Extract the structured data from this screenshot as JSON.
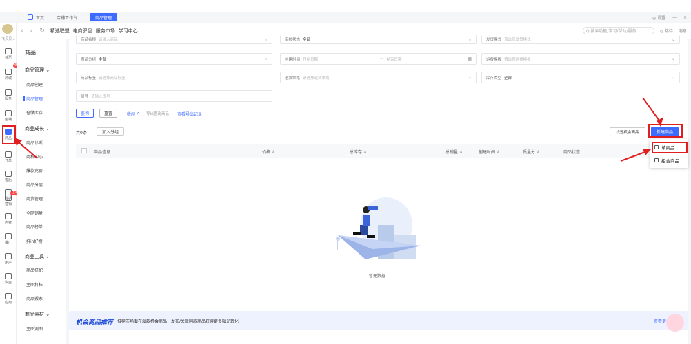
{
  "tabs": [
    {
      "label": "首页",
      "active": false
    },
    {
      "label": "店铺工作台",
      "active": false
    },
    {
      "label": "商品管理",
      "active": true
    }
  ],
  "window_controls": {
    "settings": "◎ 设置",
    "minimize": "—",
    "close": "×"
  },
  "nav": {
    "links": [
      "精选联盟",
      "电商罗盘",
      "服务市场",
      "学习中心"
    ],
    "search_placeholder": "Q 搜索功能/学习/帮助/服务",
    "service": "◎ 接待",
    "message": "消息"
  },
  "sidebar": {
    "shop_name": "飞贝贝...",
    "icons": [
      {
        "name": "home-icon",
        "label": "首页"
      },
      {
        "name": "trade-icon",
        "label": "商城"
      },
      {
        "name": "order-icon",
        "label": "服务"
      },
      {
        "name": "store-icon",
        "label": "店铺"
      },
      {
        "name": "goods-icon",
        "label": "商品",
        "active": true
      },
      {
        "name": "bill-icon",
        "label": "订单"
      },
      {
        "name": "finance-icon",
        "label": "售后"
      },
      {
        "name": "data-icon",
        "label": "数据"
      },
      {
        "name": "market-icon",
        "label": "营销"
      },
      {
        "name": "content-icon",
        "label": "内容"
      },
      {
        "name": "promo-icon",
        "label": "推广"
      },
      {
        "name": "user-icon",
        "label": "用户"
      },
      {
        "name": "funds-icon",
        "label": "资金"
      },
      {
        "name": "app-icon",
        "label": "应用"
      }
    ],
    "badge_new": "免费",
    "badge_hot": "上新"
  },
  "subnav": {
    "title": "商品",
    "groups": [
      {
        "label": "商品管理 ⌄",
        "items": [
          "商品创建",
          "商品管理",
          "仓储库存"
        ]
      },
      {
        "label": "商品成长 ⌄",
        "items": [
          "商品诊断",
          "商机中心",
          "爆款竞价",
          "商品分层",
          "商货管理",
          "全网销量",
          "商品榜单",
          "抖in好物"
        ]
      },
      {
        "label": "商品工具 ⌄",
        "items": [
          "商品搭配",
          "主图打标",
          "商品搬家"
        ]
      },
      {
        "label": "商品素材 ⌄",
        "items": [
          "主图测图"
        ]
      }
    ],
    "active_item": "商品管理"
  },
  "filters": {
    "name": {
      "label": "商品名称",
      "placeholder": "请输入商品"
    },
    "audit": {
      "label": "审核状态",
      "value": "全部"
    },
    "promo": {
      "label": "发货模式",
      "placeholder": "请选择发货模式"
    },
    "category": {
      "label": "商品分组",
      "value": "全部"
    },
    "created": {
      "label": "创建时间",
      "start": "开始日期",
      "sep": "—",
      "end": "结束日期"
    },
    "shipping": {
      "label": "运费模板",
      "placeholder": "请选择运费模板"
    },
    "tags": {
      "label": "商品标签",
      "placeholder": "请选择商品标签"
    },
    "return": {
      "label": "退货策略",
      "placeholder": "请选择退货策略"
    },
    "stock": {
      "label": "库存类型",
      "value": "全部"
    },
    "code": {
      "label": "货号",
      "placeholder": "请输入货号"
    }
  },
  "actions": {
    "query": "查询",
    "reset": "重置",
    "collapse": "收起 ^",
    "export": "导出查询商品",
    "records": "查看导出记录",
    "total": "共0条",
    "add_group": "加入分组",
    "find_opportunity": "找还机会商品",
    "new_product": "新建商品"
  },
  "table": {
    "columns": [
      "商品信息",
      "价格 ⇕",
      "总库存 ⇕",
      "总销量 ⇕",
      "创建时间 ⇕",
      "质量分 ⇕",
      "商品状态"
    ]
  },
  "dropdown": {
    "items": [
      "单商品",
      "组合商品"
    ]
  },
  "empty": "暂无数据",
  "banner": {
    "title": "机会商品推荐",
    "desc": "推荐市场潜在爆款机会商品，发布/关联同款商品获得更多曝光转化",
    "link": "查看更多"
  },
  "colors": {
    "accent": "#3e6bff",
    "highlight": "#e02020",
    "banner_title": "#1a47d6"
  }
}
